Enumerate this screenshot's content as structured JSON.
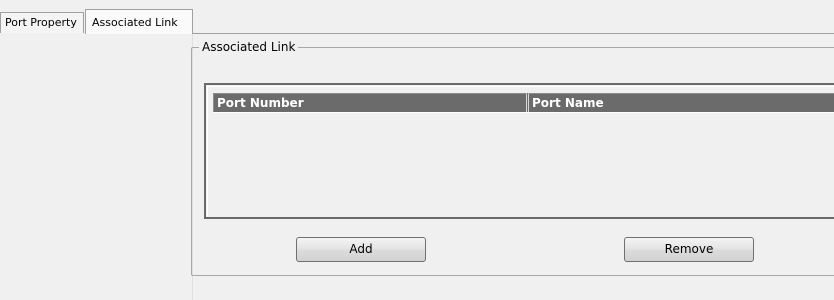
{
  "tabs": [
    {
      "label": "Port Property",
      "selected": false
    },
    {
      "label": "Associated Link",
      "selected": true
    }
  ],
  "group": {
    "title": "Associated Link"
  },
  "table": {
    "columns": [
      "Port Number",
      "Port Name"
    ],
    "rows": []
  },
  "buttons": {
    "add_label": "Add",
    "remove_label": "Remove"
  },
  "colors": {
    "background": "#f0f0f0",
    "table_header": "#6b6b6b",
    "table_header_text": "#ffffff",
    "border": "#a0a0a0"
  }
}
